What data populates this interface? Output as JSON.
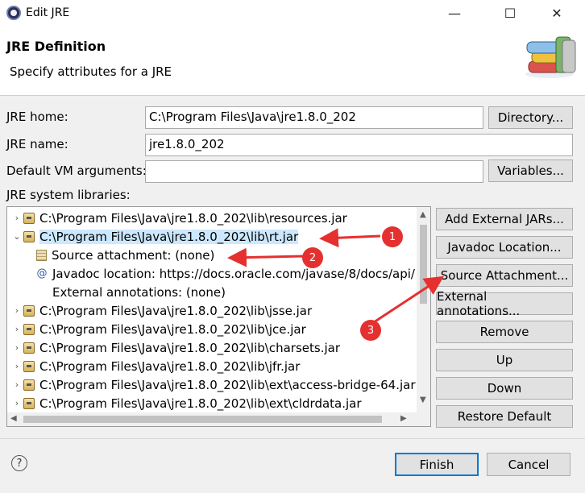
{
  "window": {
    "title": "Edit JRE",
    "minimize": "—",
    "maximize": "☐",
    "close": "✕"
  },
  "header": {
    "title": "JRE Definition",
    "subtitle": "Specify attributes for a JRE"
  },
  "form": {
    "jre_home_label": "JRE home:",
    "jre_home_value": "C:\\Program Files\\Java\\jre1.8.0_202",
    "directory_button": "Directory...",
    "jre_name_label": "JRE name:",
    "jre_name_value": "jre1.8.0_202",
    "vm_args_label": "Default VM arguments:",
    "vm_args_value": "",
    "variables_button": "Variables...",
    "libraries_label": "JRE system libraries:"
  },
  "libraries": [
    {
      "text": "C:\\Program Files\\Java\\jre1.8.0_202\\lib\\resources.jar",
      "icon": "jar-icon",
      "level": 0,
      "expander": "›"
    },
    {
      "text": "C:\\Program Files\\Java\\jre1.8.0_202\\lib\\rt.jar",
      "icon": "jar-icon",
      "level": 0,
      "expander": "⌄",
      "selected": true
    },
    {
      "text": "Source attachment: (none)",
      "icon": "source-attachment-icon",
      "level": 1,
      "expander": ""
    },
    {
      "text": "Javadoc location: https://docs.oracle.com/javase/8/docs/api/",
      "icon": "at-icon",
      "level": 1,
      "expander": ""
    },
    {
      "text": "External annotations: (none)",
      "icon": "none",
      "level": 1,
      "expander": ""
    },
    {
      "text": "C:\\Program Files\\Java\\jre1.8.0_202\\lib\\jsse.jar",
      "icon": "jar-icon",
      "level": 0,
      "expander": "›"
    },
    {
      "text": "C:\\Program Files\\Java\\jre1.8.0_202\\lib\\jce.jar",
      "icon": "jar-icon",
      "level": 0,
      "expander": "›"
    },
    {
      "text": "C:\\Program Files\\Java\\jre1.8.0_202\\lib\\charsets.jar",
      "icon": "jar-icon",
      "level": 0,
      "expander": "›"
    },
    {
      "text": "C:\\Program Files\\Java\\jre1.8.0_202\\lib\\jfr.jar",
      "icon": "jar-icon",
      "level": 0,
      "expander": "›"
    },
    {
      "text": "C:\\Program Files\\Java\\jre1.8.0_202\\lib\\ext\\access-bridge-64.jar",
      "icon": "jar-icon",
      "level": 0,
      "expander": "›"
    },
    {
      "text": "C:\\Program Files\\Java\\jre1.8.0_202\\lib\\ext\\cldrdata.jar",
      "icon": "jar-icon",
      "level": 0,
      "expander": "›"
    }
  ],
  "side_buttons": {
    "add_external_jars": "Add External JARs...",
    "javadoc_location": "Javadoc Location...",
    "source_attachment": "Source Attachment...",
    "external_annotations": "External annotations...",
    "remove": "Remove",
    "up": "Up",
    "down": "Down",
    "restore_default": "Restore Default"
  },
  "footer": {
    "help": "?",
    "finish": "Finish",
    "cancel": "Cancel"
  },
  "annotations": [
    "1",
    "2",
    "3"
  ],
  "colors": {
    "callout": "#e53030",
    "selection": "#cce8ff",
    "finish_border": "#0078d7"
  }
}
